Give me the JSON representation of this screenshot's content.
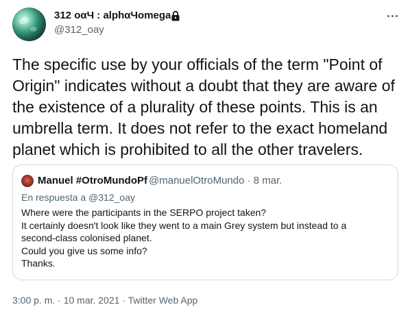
{
  "author": {
    "display_name": "312 οαЧ : alphαЧomega",
    "handle": "@312_oay"
  },
  "tweet": {
    "text": "The specific use by your officials of the term \"Point of Origin\" indicates without a doubt that they are aware of the existence of a plurality of these points. This is an umbrella term. It does not refer to the exact homeland planet which is prohibited to all the other travelers."
  },
  "quoted_tweet": {
    "display_name": "Manuel #OtroMundoPf",
    "meta": "@manuelOtroMundo · 8 mar.",
    "reply_prefix": "En respuesta a",
    "reply_to": "@312_oay",
    "lines": [
      "Where were the participants in the SERPO project taken?",
      "It certainly doesn't look like they went to a main Grey system but instead to a",
      "second-class colonised planet.",
      "Could you give us some info?",
      "Thanks."
    ]
  },
  "footer": {
    "timestamp": "3:00 p. m. · 10 mar. 2021 · Twitter Web App"
  },
  "icons": {
    "lock": "lock-icon",
    "more": "more-horizontal-icon"
  },
  "colors": {
    "text_primary": "#0f1419",
    "text_secondary": "#536471",
    "border": "#cfd9de"
  }
}
